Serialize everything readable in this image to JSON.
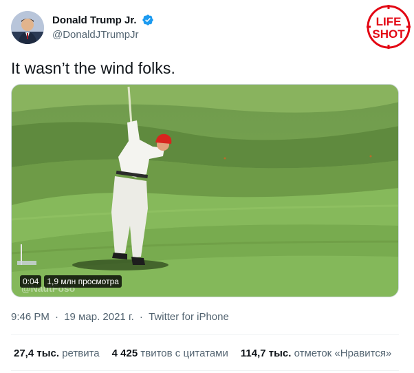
{
  "author": {
    "display_name": "Donald Trump Jr.",
    "handle": "@DonaldJTrumpJr",
    "verified": true,
    "avatar_icon": "profile-photo"
  },
  "logo": {
    "line1": "LIFE",
    "line2": "SHOT",
    "color": "#e30613"
  },
  "tweet": {
    "text": "It wasn’t the wind folks."
  },
  "video": {
    "duration": "0:04",
    "views": "1,9 млн просмотра",
    "watermark": "@NautFoso"
  },
  "meta": {
    "time": "9:46 PM",
    "separator": "·",
    "date": "19 мар. 2021 г.",
    "source": "Twitter for iPhone"
  },
  "stats": {
    "retweets_count": "27,4 тыс.",
    "retweets_label": "ретвита",
    "quotes_count": "4 425",
    "quotes_label": "твитов с цитатами",
    "likes_count": "114,7 тыс.",
    "likes_label": "отметок «Нравится»"
  },
  "colors": {
    "verified": "#1d9bf0",
    "text_secondary": "#536471",
    "text_primary": "#0f1419"
  }
}
